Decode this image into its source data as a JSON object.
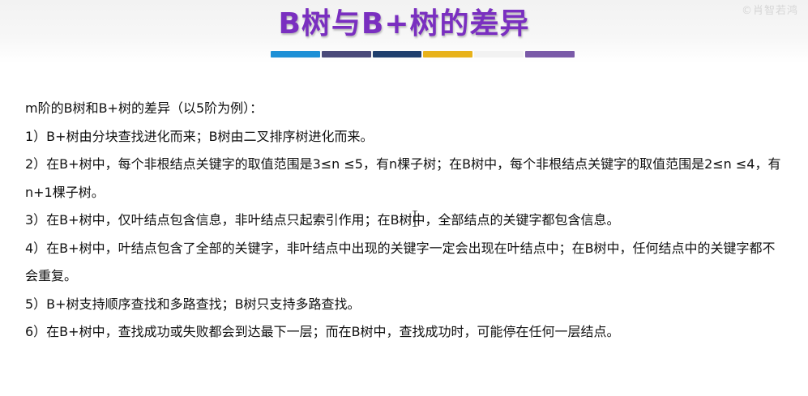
{
  "slide": {
    "title": "B树与B+树的差异",
    "watermark": "©肖智若鸿",
    "color_bar": [
      "#1e90d6",
      "#4a4a7a",
      "#1f3f6e",
      "#e8b21a",
      "#f2f2f2",
      "#7a5aa8"
    ]
  },
  "content": {
    "intro": "m阶的B树和B+树的差异（以5阶为例）：",
    "items": [
      "1）B+树由分块查找进化而来；B树由二叉排序树进化而来。",
      "2）在B+树中，每个非根结点关键字的取值范围是3≤n ≤5，有n棵子树；在B树中，每个非根结点关键字的取值范围是2≤n ≤4，有n+1棵子树。",
      "3）在B+树中，仅叶结点包含信息，非叶结点只起索引作用；在B树中，全部结点的关键字都包含信息。",
      "4）在B+树中，叶结点包含了全部的关键字，非叶结点中出现的关键字一定会出现在叶结点中；在B树中，任何结点中的关键字都不会重复。",
      "5）B+树支持顺序查找和多路查找；B树只支持多路查找。",
      "6）在B+树中，查找成功或失败都会到达最下一层；而在B树中，查找成功时，可能停在任何一层结点。"
    ]
  }
}
